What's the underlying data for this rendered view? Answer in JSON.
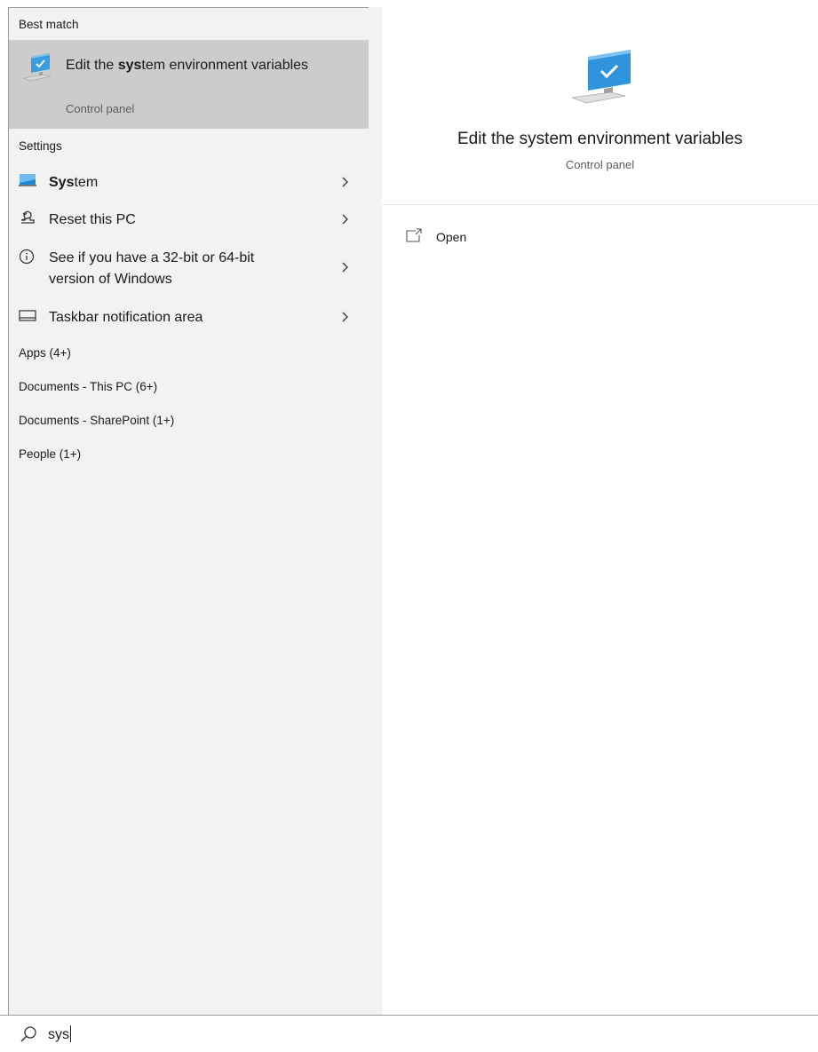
{
  "best_match": {
    "section_label": "Best match",
    "title_before": "Edit the ",
    "title_bold": "sys",
    "title_after": "tem environment variables",
    "subtitle": "Control panel",
    "icon": "monitor-check-icon"
  },
  "settings": {
    "section_label": "Settings",
    "items": [
      {
        "label_bold": "Sys",
        "label_rest": "tem",
        "icon": "monitor-icon"
      },
      {
        "label": "Reset this PC",
        "icon": "reset-pc-icon"
      },
      {
        "label_line1": "See if you have a 32-bit or 64-bit",
        "label_line2": "version of Windows",
        "icon": "info-icon"
      },
      {
        "label": "Taskbar notification area",
        "icon": "taskbar-icon"
      }
    ]
  },
  "categories": [
    "Apps (4+)",
    "Documents - This PC (6+)",
    "Documents - SharePoint (1+)",
    "People (1+)"
  ],
  "detail": {
    "title": "Edit the system environment variables",
    "subtitle": "Control panel",
    "actions": [
      {
        "label": "Open",
        "icon": "open-window-icon"
      }
    ]
  },
  "search": {
    "value": "sys",
    "icon": "search-icon"
  },
  "colors": {
    "pane_bg": "#f2f2f2",
    "selected_bg": "#cccccc",
    "accent": "#1e8ad6"
  }
}
